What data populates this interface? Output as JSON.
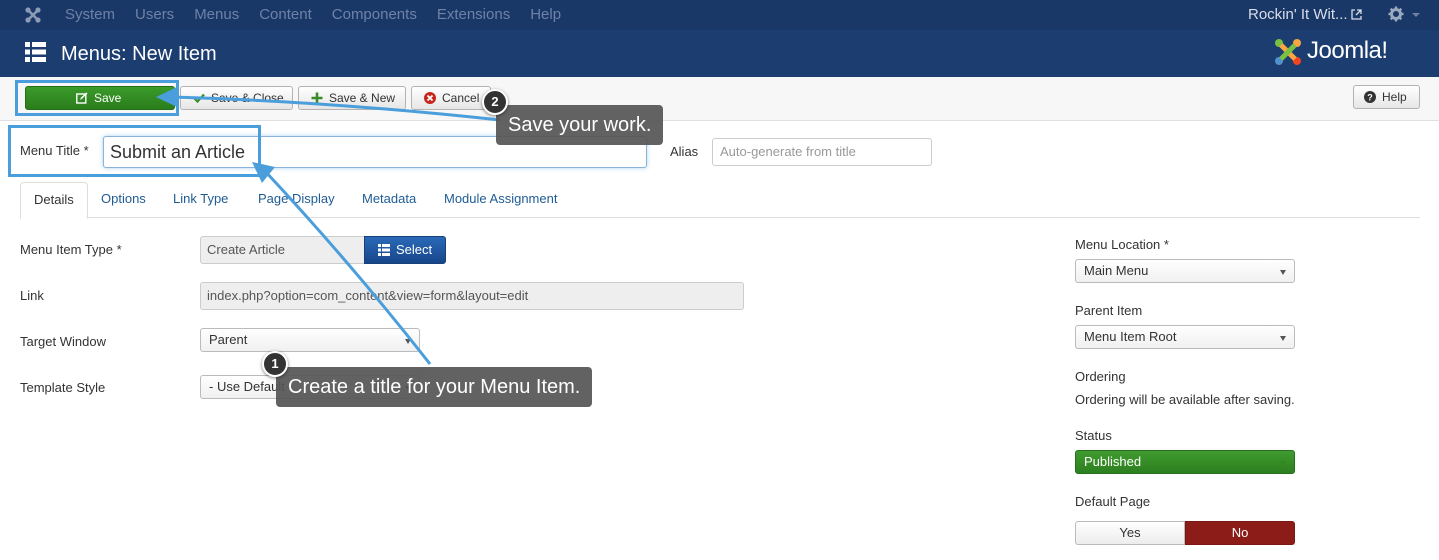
{
  "top_nav": {
    "items": [
      "System",
      "Users",
      "Menus",
      "Content",
      "Components",
      "Extensions",
      "Help"
    ],
    "site_name": "Rockin' It Wit...",
    "icons": [
      "joomla-icon",
      "external-link-icon",
      "gear-icon",
      "caret-down-icon"
    ]
  },
  "header": {
    "title": "Menus: New Item",
    "brand": "Joomla!"
  },
  "toolbar": {
    "save": "Save",
    "save_close": "Save & Close",
    "save_new": "Save & New",
    "cancel": "Cancel",
    "help": "Help"
  },
  "form": {
    "menu_title_label": "Menu Title *",
    "menu_title_value": "Submit an Article",
    "alias_label": "Alias",
    "alias_placeholder": "Auto-generate from title",
    "tabs": [
      "Details",
      "Options",
      "Link Type",
      "Page Display",
      "Metadata",
      "Module Assignment"
    ],
    "active_tab": "Details",
    "menu_item_type_label": "Menu Item Type *",
    "menu_item_type_value": "Create Article",
    "select_label": "Select",
    "link_label": "Link",
    "link_value": "index.php?option=com_content&view=form&layout=edit",
    "target_window_label": "Target Window",
    "target_window_value": "Parent",
    "template_style_label": "Template Style",
    "template_style_value": "- Use Default -"
  },
  "sidebar": {
    "menu_location_label": "Menu Location *",
    "menu_location_value": "Main Menu",
    "parent_item_label": "Parent Item",
    "parent_item_value": "Menu Item Root",
    "ordering_label": "Ordering",
    "ordering_text": "Ordering will be available after saving.",
    "status_label": "Status",
    "status_value": "Published",
    "default_page_label": "Default Page",
    "default_yes": "Yes",
    "default_no": "No"
  },
  "annotations": {
    "step1_number": "1",
    "step1_text": "Create a title for your Menu Item.",
    "step2_number": "2",
    "step2_text": "Save your work.",
    "highlight_color": "#4a9edb"
  },
  "colors": {
    "nav_bg": "#1a3867",
    "header_bg": "#1c3d70",
    "save_green": "#2b7d1c",
    "select_blue": "#17468a",
    "no_red": "#8c1c17"
  }
}
